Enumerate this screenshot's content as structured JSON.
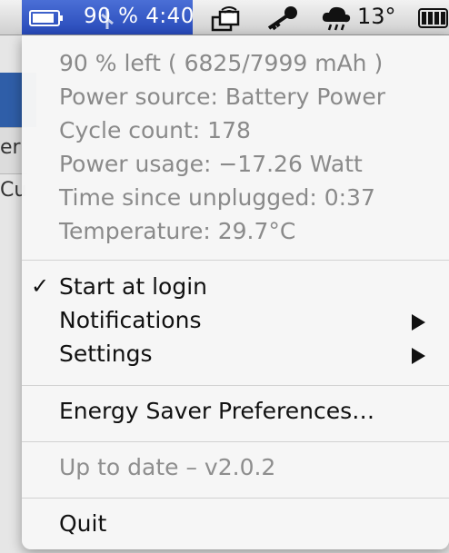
{
  "menubar": {
    "status_text": "90 % 4:40",
    "temperature": "13°",
    "icons": [
      "battery-icon",
      "plug-icon",
      "network-icon",
      "key-icon",
      "weather-icon",
      "battery-status-icon"
    ]
  },
  "background": {
    "frag_er": "er",
    "frag_cu": "Cu"
  },
  "menu": {
    "info": [
      "90 % left ( 6825/7999 mAh )",
      "Power source: Battery Power",
      "Cycle count: 178",
      "Power usage: −17.26 Watt",
      "Time since unplugged: 0:37",
      "Temperature: 29.7°C"
    ],
    "start_at_login": {
      "check": "✓",
      "label": "Start at login"
    },
    "notifications": "Notifications",
    "settings": "Settings",
    "energy_saver": "Energy Saver Preferences…",
    "update_status": "Up to date – v2.0.2",
    "quit": "Quit"
  }
}
